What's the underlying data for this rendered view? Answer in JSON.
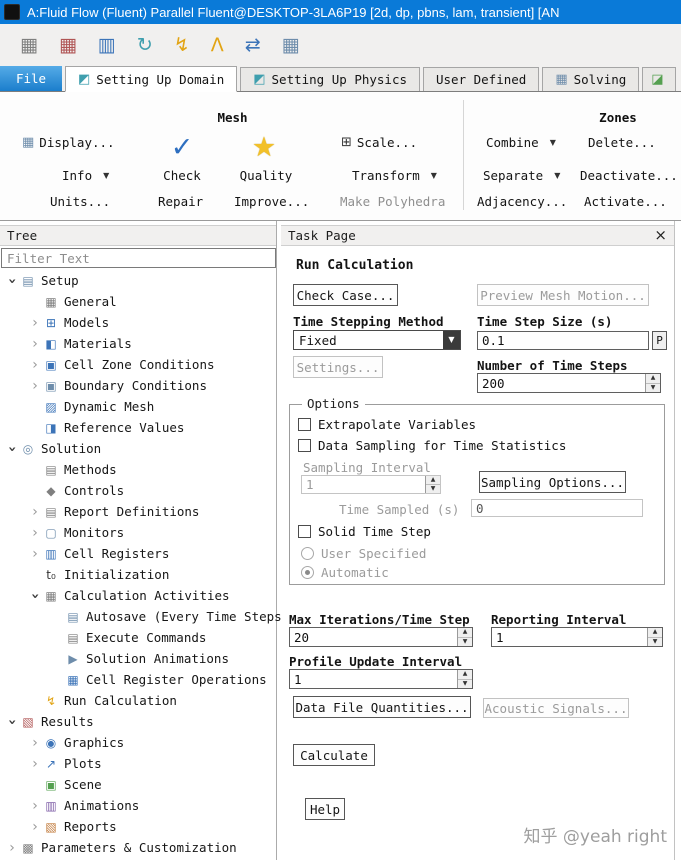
{
  "title_bar": {
    "title": "A:Fluid Flow (Fluent) Parallel Fluent@DESKTOP-3LA6P19  [2d, dp, pbns, lam, transient] [AN"
  },
  "toolbar": {
    "icons": [
      {
        "name": "graphics-mesh-icon",
        "glyph": "▦",
        "ic": "ic-gray"
      },
      {
        "name": "mesh-quality-icon",
        "glyph": "▦",
        "ic": "ic-red"
      },
      {
        "name": "zones-database-icon",
        "glyph": "▥",
        "ic": "ic-blue"
      },
      {
        "name": "refresh-case-icon",
        "glyph": "↻",
        "ic": "ic-teal"
      },
      {
        "name": "run-calculation-icon",
        "glyph": "↯",
        "ic": "ic-gold"
      },
      {
        "name": "ansys-logo-icon",
        "glyph": "Λ",
        "ic": "ic-gold"
      },
      {
        "name": "window-arrange-icon",
        "glyph": "⇄",
        "ic": "ic-blue"
      },
      {
        "name": "workspace-layout-icon",
        "glyph": "▦",
        "ic": "ic-steel"
      }
    ]
  },
  "tabs": {
    "file": "File",
    "items": [
      {
        "label": "Setting Up Domain",
        "cls": "on",
        "glyph": "◩",
        "ic": "ic-teal"
      },
      {
        "label": "Setting Up Physics",
        "cls": "",
        "glyph": "◩",
        "ic": "ic-teal"
      },
      {
        "label": "User Defined",
        "cls": "",
        "glyph": "",
        "ic": ""
      },
      {
        "label": "Solving",
        "cls": "",
        "glyph": "▦",
        "ic": "ic-steel"
      },
      {
        "label": "",
        "cls": "cut",
        "glyph": "◪",
        "ic": "ic-green"
      }
    ]
  },
  "ribbon": {
    "mesh_group_title": "Mesh",
    "zones_group_title": "Zones",
    "display": "Display...",
    "info": "Info",
    "units": "Units...",
    "check": "Check",
    "quality": "Quality",
    "repair": "Repair",
    "improve": "Improve...",
    "scale": "Scale...",
    "transform": "Transform",
    "make_polyhedra": "Make Polyhedra",
    "combine": "Combine",
    "delete": "Delete...",
    "separate": "Separate",
    "deactivate": "Deactivate...",
    "adjacency": "Adjacency...",
    "activate": "Activate..."
  },
  "tree": {
    "header": "Tree",
    "filter_placeholder": "Filter Text",
    "items": [
      {
        "label": "Setup",
        "lvl": "lvl0",
        "exp": "exp-o",
        "icon": "setup-icon",
        "glyph": "▤",
        "ic": "ic-steel"
      },
      {
        "label": "General",
        "lvl": "lvl1",
        "exp": "exp-n",
        "icon": "general-icon",
        "glyph": "▦",
        "ic": "ic-gray"
      },
      {
        "label": "Models",
        "lvl": "lvl1",
        "exp": "exp-c",
        "icon": "models-icon",
        "glyph": "⊞",
        "ic": "ic-blue"
      },
      {
        "label": "Materials",
        "lvl": "lvl1",
        "exp": "exp-c",
        "icon": "materials-icon",
        "glyph": "◧",
        "ic": "ic-blue"
      },
      {
        "label": "Cell Zone Conditions",
        "lvl": "lvl1",
        "exp": "exp-c",
        "icon": "cell-zone-conditions-icon",
        "glyph": "▣",
        "ic": "ic-blue"
      },
      {
        "label": "Boundary Conditions",
        "lvl": "lvl1",
        "exp": "exp-c",
        "icon": "boundary-conditions-icon",
        "glyph": "▣",
        "ic": "ic-steel"
      },
      {
        "label": "Dynamic Mesh",
        "lvl": "lvl1",
        "exp": "exp-n",
        "icon": "dynamic-mesh-icon",
        "glyph": "▨",
        "ic": "ic-blue"
      },
      {
        "label": "Reference Values",
        "lvl": "lvl1",
        "exp": "exp-n",
        "icon": "reference-values-icon",
        "glyph": "◨",
        "ic": "ic-blue"
      },
      {
        "label": "Solution",
        "lvl": "lvl0",
        "exp": "exp-o",
        "icon": "solution-icon",
        "glyph": "◎",
        "ic": "ic-steel"
      },
      {
        "label": "Methods",
        "lvl": "lvl1",
        "exp": "exp-n",
        "icon": "methods-icon",
        "glyph": "▤",
        "ic": "ic-gray"
      },
      {
        "label": "Controls",
        "lvl": "lvl1",
        "exp": "exp-n",
        "icon": "controls-icon",
        "glyph": "◆",
        "ic": "ic-gray"
      },
      {
        "label": "Report Definitions",
        "lvl": "lvl1",
        "exp": "exp-c",
        "icon": "report-definitions-icon",
        "glyph": "▤",
        "ic": "ic-gray"
      },
      {
        "label": "Monitors",
        "lvl": "lvl1",
        "exp": "exp-c",
        "icon": "monitors-icon",
        "glyph": "▢",
        "ic": "ic-steel"
      },
      {
        "label": "Cell Registers",
        "lvl": "lvl1",
        "exp": "exp-c",
        "icon": "cell-registers-icon",
        "glyph": "▥",
        "ic": "ic-blue"
      },
      {
        "label": "Initialization",
        "lvl": "lvl1",
        "exp": "exp-n",
        "icon": "initialization-icon",
        "glyph": "t₀",
        "ic": "ic-dark"
      },
      {
        "label": "Calculation Activities",
        "lvl": "lvl1",
        "exp": "exp-o",
        "icon": "calculation-activities-icon",
        "glyph": "▦",
        "ic": "ic-gray"
      },
      {
        "label": "Autosave (Every Time Steps)",
        "lvl": "lvl2",
        "exp": "exp-n",
        "icon": "autosave-icon",
        "glyph": "▤",
        "ic": "ic-steel"
      },
      {
        "label": "Execute Commands",
        "lvl": "lvl2",
        "exp": "exp-n",
        "icon": "execute-commands-icon",
        "glyph": "▤",
        "ic": "ic-gray"
      },
      {
        "label": "Solution Animations",
        "lvl": "lvl2",
        "exp": "exp-n",
        "icon": "solution-animations-icon",
        "glyph": "▶",
        "ic": "ic-steel"
      },
      {
        "label": "Cell Register Operations",
        "lvl": "lvl2",
        "exp": "exp-n",
        "icon": "cell-register-operations-icon",
        "glyph": "▦",
        "ic": "ic-blue"
      },
      {
        "label": "Run Calculation",
        "lvl": "lvl1",
        "exp": "exp-n",
        "icon": "run-calculation-icon",
        "glyph": "↯",
        "ic": "ic-gold"
      },
      {
        "label": "Results",
        "lvl": "lvl0",
        "exp": "exp-o",
        "icon": "results-icon",
        "glyph": "▧",
        "ic": "ic-red"
      },
      {
        "label": "Graphics",
        "lvl": "lvl1",
        "exp": "exp-c",
        "icon": "graphics-icon",
        "glyph": "◉",
        "ic": "ic-blue"
      },
      {
        "label": "Plots",
        "lvl": "lvl1",
        "exp": "exp-c",
        "icon": "plots-icon",
        "glyph": "↗",
        "ic": "ic-blue"
      },
      {
        "label": "Scene",
        "lvl": "lvl1",
        "exp": "exp-n",
        "icon": "scene-icon",
        "glyph": "▣",
        "ic": "ic-green"
      },
      {
        "label": "Animations",
        "lvl": "lvl1",
        "exp": "exp-c",
        "icon": "animations-icon",
        "glyph": "▥",
        "ic": "ic-purple"
      },
      {
        "label": "Reports",
        "lvl": "lvl1",
        "exp": "exp-c",
        "icon": "reports-icon",
        "glyph": "▧",
        "ic": "ic-orange"
      },
      {
        "label": "Parameters & Customization",
        "lvl": "lvl0",
        "exp": "exp-c",
        "icon": "parameters-customization-icon",
        "glyph": "▩",
        "ic": "ic-gray"
      }
    ]
  },
  "task_page": {
    "header": "Task Page",
    "title": "Run Calculation",
    "check_case": "Check Case...",
    "preview_mesh_motion": "Preview Mesh Motion...",
    "time_stepping_method_label": "Time Stepping Method",
    "time_stepping_method_value": "Fixed",
    "time_step_size_label": "Time Step Size (s)",
    "time_step_size_value": "0.1",
    "p_button": "P",
    "settings": "Settings...",
    "number_of_time_steps_label": "Number of Time Steps",
    "number_of_time_steps_value": "200",
    "options_title": "Options",
    "extrapolate_variables": "Extrapolate Variables",
    "data_sampling": "Data Sampling for Time Statistics",
    "sampling_interval_label": "Sampling Interval",
    "sampling_interval_value": "1",
    "sampling_options": "Sampling Options...",
    "time_sampled_label": "Time Sampled (s)",
    "time_sampled_value": "0",
    "solid_time_step": "Solid Time Step",
    "user_specified": "User Specified",
    "automatic": "Automatic",
    "max_iterations_label": "Max Iterations/Time Step",
    "max_iterations_value": "20",
    "reporting_interval_label": "Reporting Interval",
    "reporting_interval_value": "1",
    "profile_update_interval_label": "Profile Update Interval",
    "profile_update_interval_value": "1",
    "data_file_quantities": "Data File Quantities...",
    "acoustic_signals": "Acoustic Signals...",
    "calculate": "Calculate",
    "help": "Help"
  },
  "watermark": "知乎 @yeah right"
}
